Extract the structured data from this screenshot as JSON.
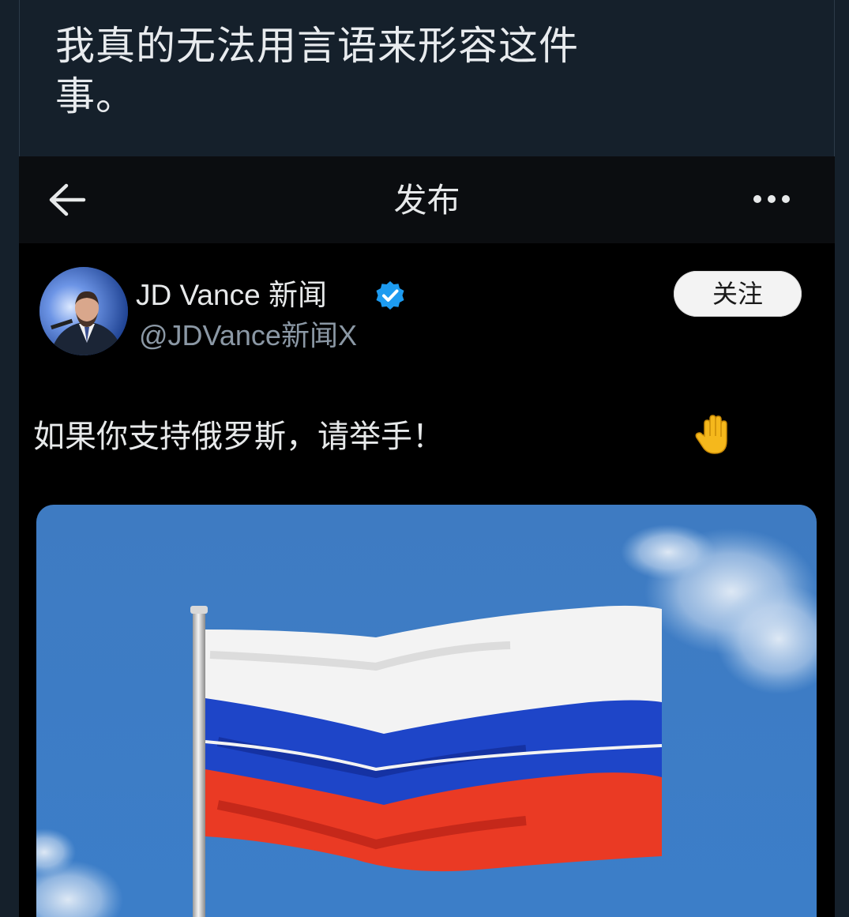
{
  "outer_post": {
    "text": "我真的无法用言语来形容这件事。"
  },
  "screenshot": {
    "topbar": {
      "title": "发布",
      "back_icon": "arrow-left-icon",
      "more_icon": "more-dots-icon"
    },
    "author": {
      "display_name": "JD Vance 新闻",
      "handle": "@JDVance新闻X",
      "verified_icon": "verified-badge-icon",
      "verified_color": "#1d9bf0"
    },
    "follow_button": {
      "label": "关注"
    },
    "tweet": {
      "text": "如果你支持俄罗斯，请举手！",
      "emoji": "raised-hand-icon"
    },
    "media": {
      "description_icon": "russian-flag-image",
      "colors": {
        "sky": "#3f7fc4",
        "flag_white": "#f2f2f2",
        "flag_blue": "#1f46c8",
        "flag_red": "#ea3a24"
      }
    }
  },
  "colors": {
    "background": "#15202b",
    "screenshot_bg": "#000000",
    "text_primary": "#e7e9ea",
    "text_secondary": "#8b98a5"
  }
}
